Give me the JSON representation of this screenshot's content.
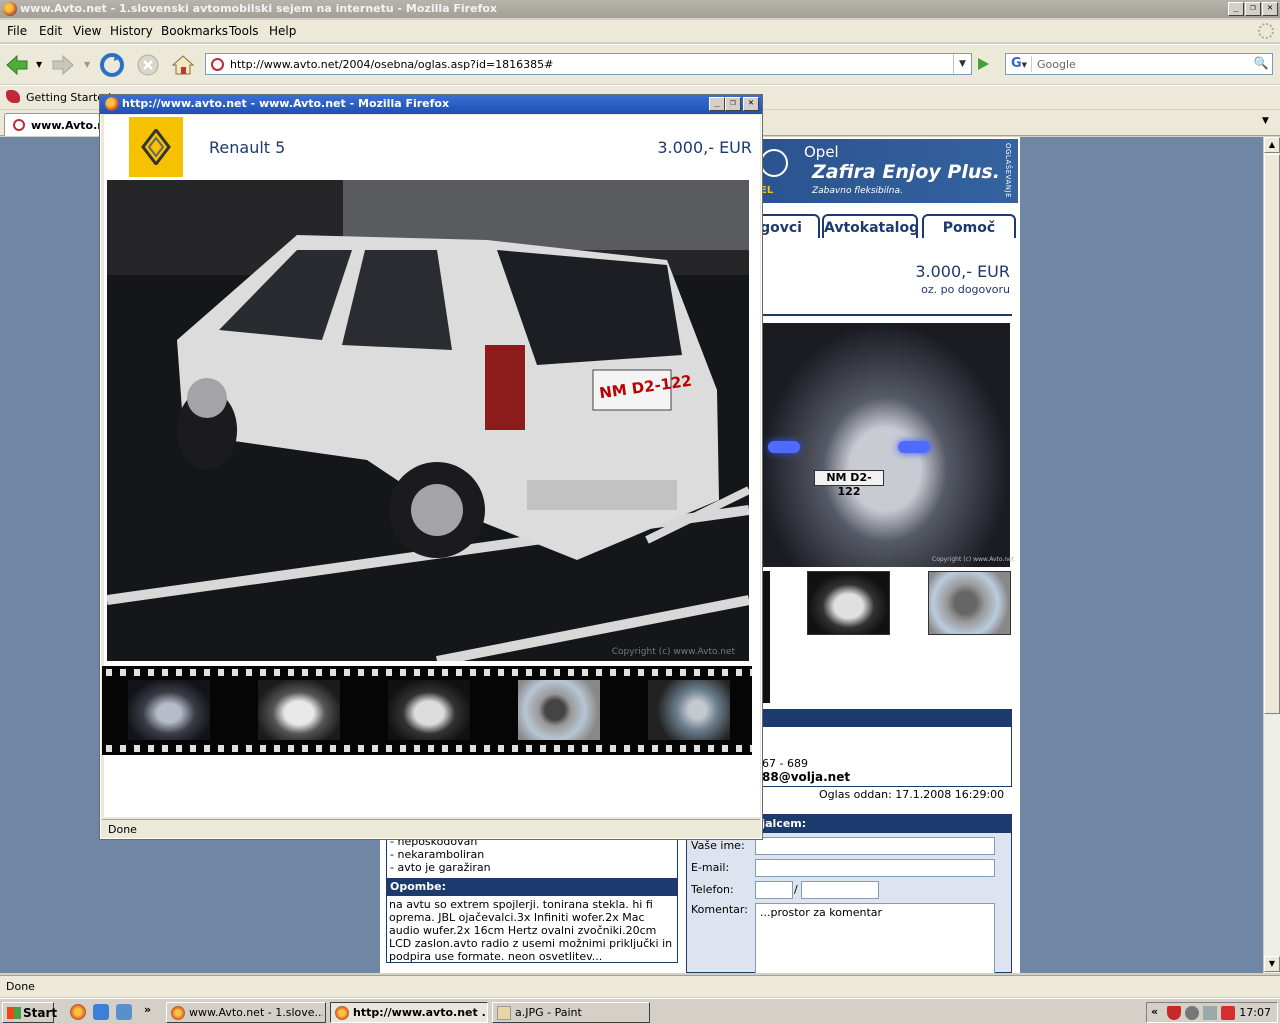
{
  "window": {
    "title": "www.Avto.net - 1.slovenski avtomobilski sejem na internetu - Mozilla Firefox"
  },
  "menu": [
    "File",
    "Edit",
    "View",
    "History",
    "Bookmarks",
    "Tools",
    "Help"
  ],
  "nav": {
    "url": "http://www.avto.net/2004/osebna/oglas.asp?id=1816385#",
    "search_placeholder": "Google"
  },
  "bookmarks": {
    "first": "Getting Started"
  },
  "tabs": [
    {
      "label": "www.Avto.ne"
    }
  ],
  "background_page": {
    "banner": {
      "brand": "Opel",
      "model": "Zafira Enjoy Plus.",
      "tagline": "Zabavno fleksibilna.",
      "logo_text": "EL",
      "side_text": "OGLAŠEVANJE"
    },
    "tabs": [
      "govci",
      "Avtokatalog",
      "Pomoč"
    ],
    "price": "3.000,- EUR",
    "price_note": "oz. po dogovoru",
    "plate": "NM  D2-122",
    "photo_copyright": "Copyright (c) www.Avto.net",
    "phone": "67 - 689",
    "email": "88@volja.net",
    "date": "Oglas oddan: 17.1.2008 16:29:00",
    "features": [
      "- nepoškodovan",
      "- nekaramboliran",
      "- avto je garažiran"
    ],
    "notes_heading": "Opombe:",
    "notes": "na avtu so extrem spojlerji. tonirana stekla. hi fi oprema. JBL ojačevalci.3x Infiniti wofer.2x Mac audio wufer.2x 16cm Hertz ovalni zvočniki.20cm LCD zaslon.avto radio z usemi možnimi priključki in podpira use formate. neon osvetlitev...",
    "contact": {
      "heading": "akt s prodajalcem:",
      "name_label": "Vaše ime:",
      "email_label": "E-mail:",
      "phone_label": "Telefon:",
      "phone_sep": "/",
      "comment_label": "Komentar:",
      "comment_placeholder": "...prostor za komentar"
    }
  },
  "popup": {
    "title": "http://www.avto.net - www.Avto.net - Mozilla Firefox",
    "car_name": "Renault 5",
    "price": "3.000,- EUR",
    "plate": "NM  D2-122",
    "copyright": "Copyright (c) www.Avto.net",
    "status": "Done"
  },
  "status": "Done",
  "taskbar": {
    "start": "Start",
    "overflow": "»",
    "items": [
      {
        "label": "www.Avto.net - 1.slove..."
      },
      {
        "label": "http://www.avto.net ..."
      },
      {
        "label": "a.JPG - Paint"
      }
    ],
    "tray_chevron": "«",
    "clock": "17:07"
  }
}
